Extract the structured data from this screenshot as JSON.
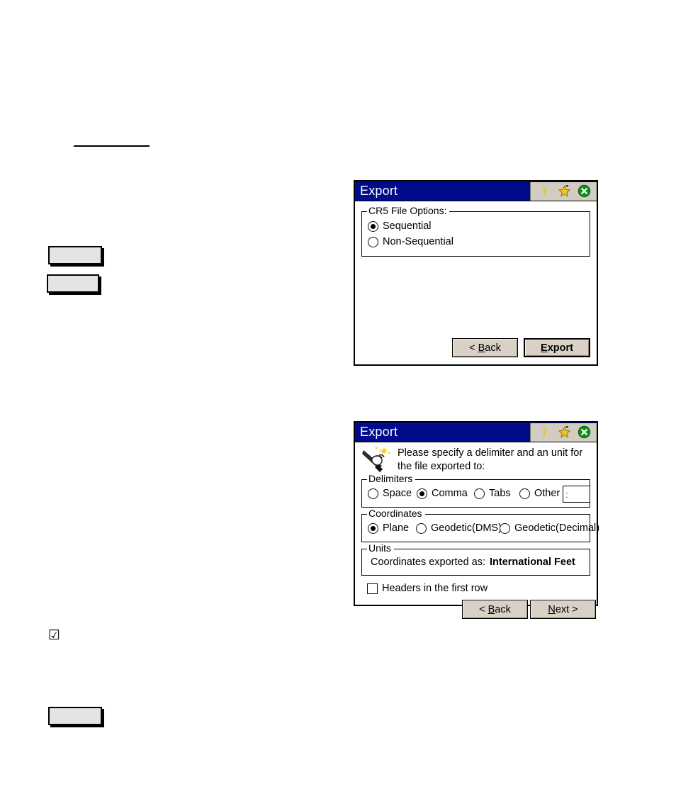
{
  "page": {
    "background": "#ffffff",
    "separator_rule": {
      "visible": true
    }
  },
  "placeholders": [
    {
      "name": "blank-button-1"
    },
    {
      "name": "blank-button-2"
    },
    {
      "name": "blank-button-3"
    }
  ],
  "page_marks": {
    "checked_checkbox_glyph": "☑"
  },
  "dialog1": {
    "title": "Export",
    "titlebar_color": "#000b8c",
    "title_buttons": [
      {
        "name": "help-icon",
        "glyph": "?"
      },
      {
        "name": "star-icon",
        "glyph": "★"
      },
      {
        "name": "close-icon",
        "glyph": "✕",
        "color": "#008000"
      }
    ],
    "group": {
      "legend": "CR5 File Options:",
      "options": [
        {
          "label": "Sequential",
          "selected": true
        },
        {
          "label": "Non-Sequential",
          "selected": false
        }
      ]
    },
    "buttons": {
      "back": {
        "label": "< Back",
        "accel": "B",
        "default": false
      },
      "export": {
        "label": "Export",
        "accel": "E",
        "default": true
      }
    }
  },
  "dialog2": {
    "title": "Export",
    "titlebar_color": "#000b8c",
    "title_buttons": [
      {
        "name": "help-icon",
        "glyph": "?"
      },
      {
        "name": "star-icon",
        "glyph": "★"
      },
      {
        "name": "close-icon",
        "glyph": "✕",
        "color": "#008000"
      }
    ],
    "wizard_icon": "hand-wand-icon",
    "instruction": "Please specify a delimiter and an unit for\nthe file exported to:",
    "delimiters": {
      "legend": "Delimiters",
      "options": [
        {
          "label": "Space",
          "selected": false
        },
        {
          "label": "Comma",
          "selected": true
        },
        {
          "label": "Tabs",
          "selected": false
        },
        {
          "label": "Other",
          "selected": false
        }
      ],
      "other_value": ":"
    },
    "coordinates": {
      "legend": "Coordinates",
      "options": [
        {
          "label": "Plane",
          "selected": true
        },
        {
          "label": "Geodetic(DMS)",
          "selected": false
        },
        {
          "label": "Geodetic(Decimal)",
          "selected": false
        }
      ]
    },
    "units": {
      "legend": "Units",
      "label": "Coordinates exported as:",
      "value": "International Feet"
    },
    "headers_checkbox": {
      "label": "Headers in the first row",
      "checked": false
    },
    "buttons": {
      "back": {
        "label": "< Back",
        "accel": "B",
        "default": false
      },
      "next": {
        "label": "Next >",
        "accel": "N",
        "default": false
      }
    }
  }
}
